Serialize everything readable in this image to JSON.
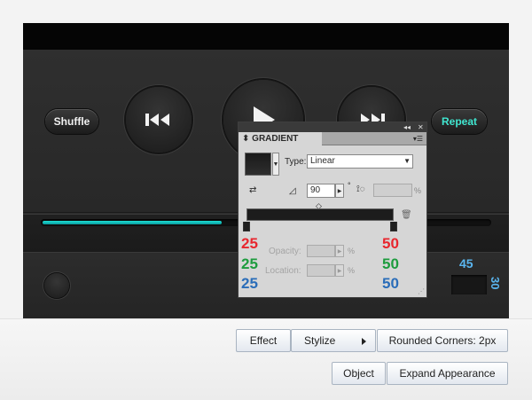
{
  "player": {
    "shuffle_label": "Shuffle",
    "repeat_label": "Repeat",
    "progress": 0.4,
    "number_45": "45",
    "number_30": "30"
  },
  "gradient_panel": {
    "title": "GRADIENT",
    "type_label": "Type:",
    "type_value": "Linear",
    "angle_value": "90",
    "degree_symbol": "°",
    "percent_symbol": "%",
    "opacity_label": "Opacity:",
    "location_label": "Location:",
    "left_stop": {
      "r": "25",
      "g": "25",
      "b": "25"
    },
    "right_stop": {
      "r": "50",
      "g": "50",
      "b": "50"
    }
  },
  "menu": {
    "effect": "Effect",
    "stylize": "Stylize",
    "rounded_corners": "Rounded Corners: 2px",
    "object": "Object",
    "expand_appearance": "Expand Appearance"
  },
  "colors": {
    "accent": "#1ee0d6",
    "repeat_text": "#40e6d0",
    "red": "#e8262e",
    "green": "#1d9c3e",
    "blue": "#2a6db9"
  },
  "icons": [
    "rewind-icon",
    "play-icon",
    "fast-forward-icon",
    "reverse-gradient-icon",
    "angle-icon",
    "aspect-ratio-icon",
    "delete-stop-icon",
    "panel-menu-icon"
  ]
}
